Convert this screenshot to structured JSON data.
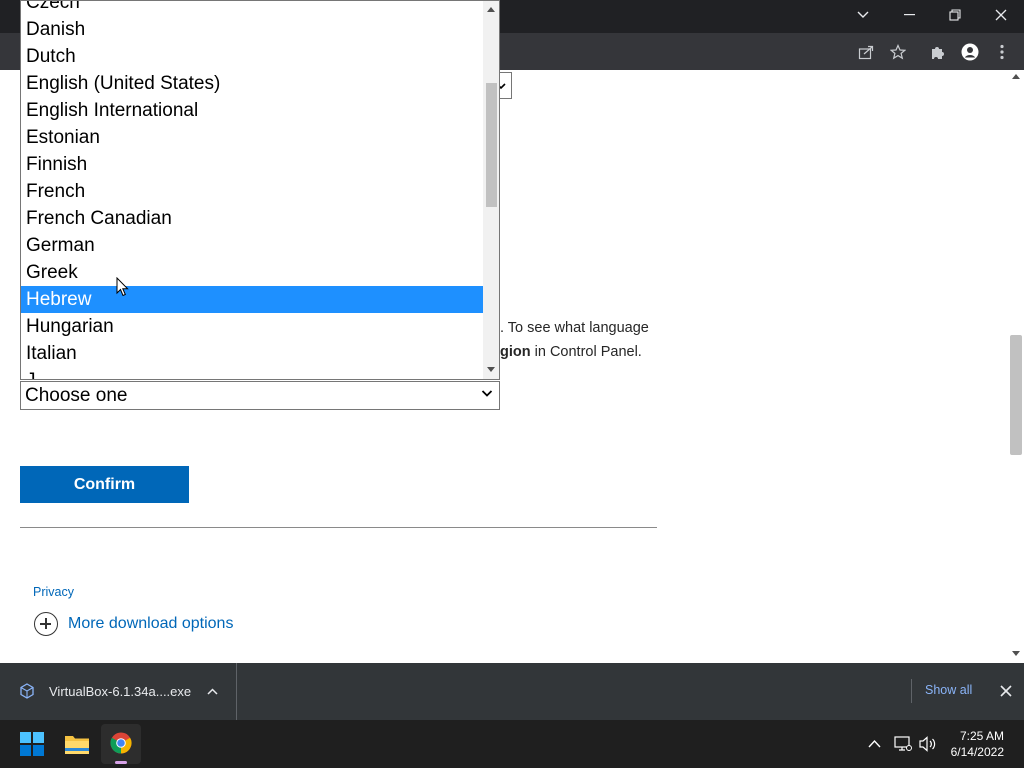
{
  "browser": {
    "window_controls": {
      "chevron": "chevron-down-icon",
      "minimize": "minimize-icon",
      "restore": "restore-icon",
      "close": "close-icon"
    },
    "toolbar_icons": [
      "share-icon",
      "star-icon",
      "extensions-icon",
      "profile-icon",
      "menu-icon"
    ]
  },
  "page": {
    "info_line1": ". To see what language",
    "info_line2_bold": "gion",
    "info_line2_rest": " in Control Panel.",
    "select_value": "Choose one",
    "confirm_label": "Confirm",
    "privacy_link": "Privacy",
    "more_options": "More download options"
  },
  "dropdown": {
    "options": [
      "Czech",
      "Danish",
      "Dutch",
      "English (United States)",
      "English International",
      "Estonian",
      "Finnish",
      "French",
      "French Canadian",
      "German",
      "Greek",
      "Hebrew",
      "Hungarian",
      "Italian",
      "J"
    ],
    "selected": "Hebrew"
  },
  "downloads": {
    "file_name": "VirtualBox-6.1.34a....exe",
    "show_all": "Show all"
  },
  "taskbar": {
    "time": "7:25 AM",
    "date": "6/14/2022",
    "apps": [
      "windows-start-icon",
      "file-explorer-icon",
      "chrome-icon"
    ]
  },
  "colors": {
    "accent": "#0067b8",
    "selection": "#1e90ff"
  }
}
